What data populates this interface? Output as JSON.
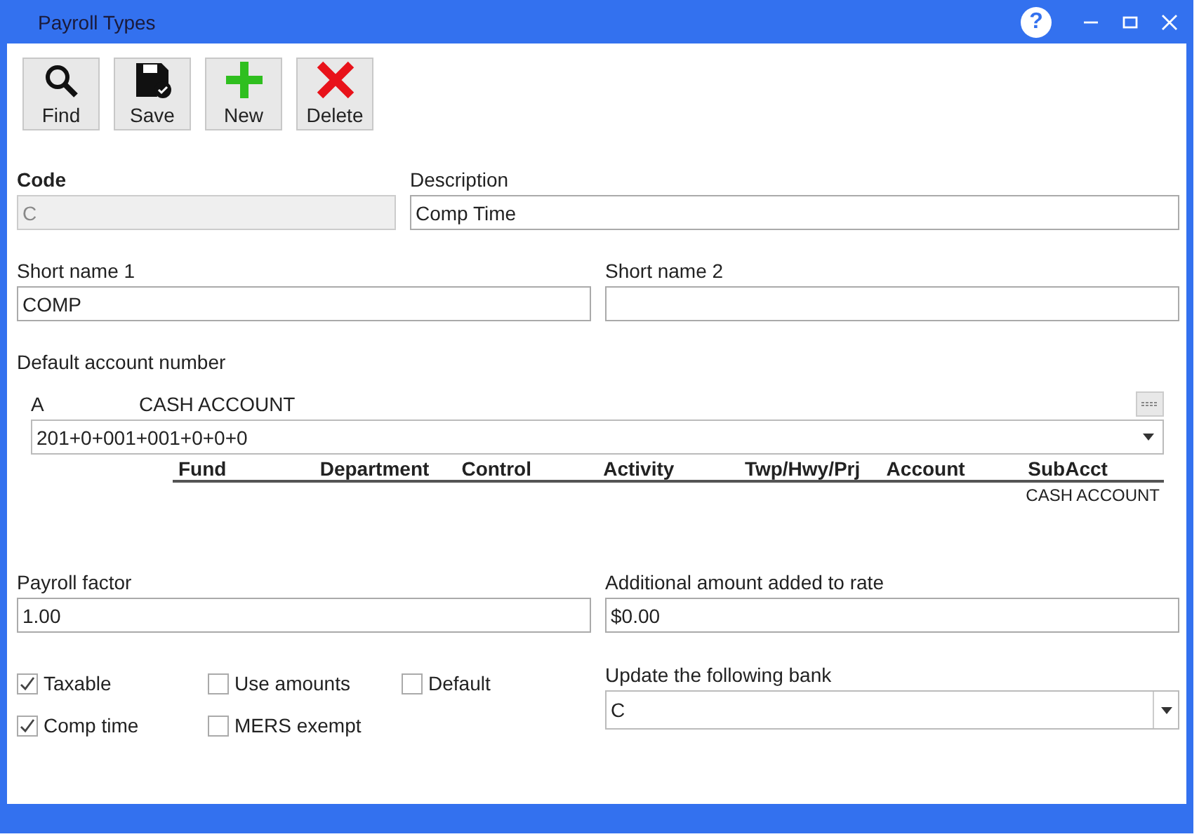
{
  "window": {
    "title": "Payroll Types",
    "help": "?"
  },
  "toolbar": [
    {
      "kind": "find",
      "label": "Find"
    },
    {
      "kind": "save",
      "label": "Save"
    },
    {
      "kind": "new",
      "label": "New"
    },
    {
      "kind": "delete",
      "label": "Delete"
    }
  ],
  "code": {
    "label": "Code",
    "value": "C",
    "disabled": true
  },
  "description": {
    "label": "Description",
    "value": "Comp Time"
  },
  "short_name_1": {
    "label": "Short name 1",
    "value": "COMP"
  },
  "short_name_2": {
    "label": "Short name 2"
  },
  "default_account": {
    "label": "Default account number",
    "code": "A",
    "name": "CASH ACCOUNT",
    "value": "201+0+001+001+0+0+0",
    "columns": [
      "Fund",
      "Department",
      "Control",
      "Activity",
      "Twp/Hwy/Prj",
      "Account",
      "SubAcct"
    ],
    "subacct_name": "CASH ACCOUNT"
  },
  "payroll_factor": {
    "label": "Payroll factor",
    "value": "1.00"
  },
  "additional_amount": {
    "label": "Additional amount added to rate",
    "value": "$0.00"
  },
  "checkboxes": [
    {
      "label": "Taxable",
      "checked": true
    },
    {
      "label": "Use amounts",
      "checked": false
    },
    {
      "label": "Default",
      "checked": false
    },
    {
      "label": "Comp time",
      "checked": true
    },
    {
      "label": "MERS exempt",
      "checked": false
    }
  ],
  "bank": {
    "label": "Update the following bank",
    "value": "C"
  }
}
